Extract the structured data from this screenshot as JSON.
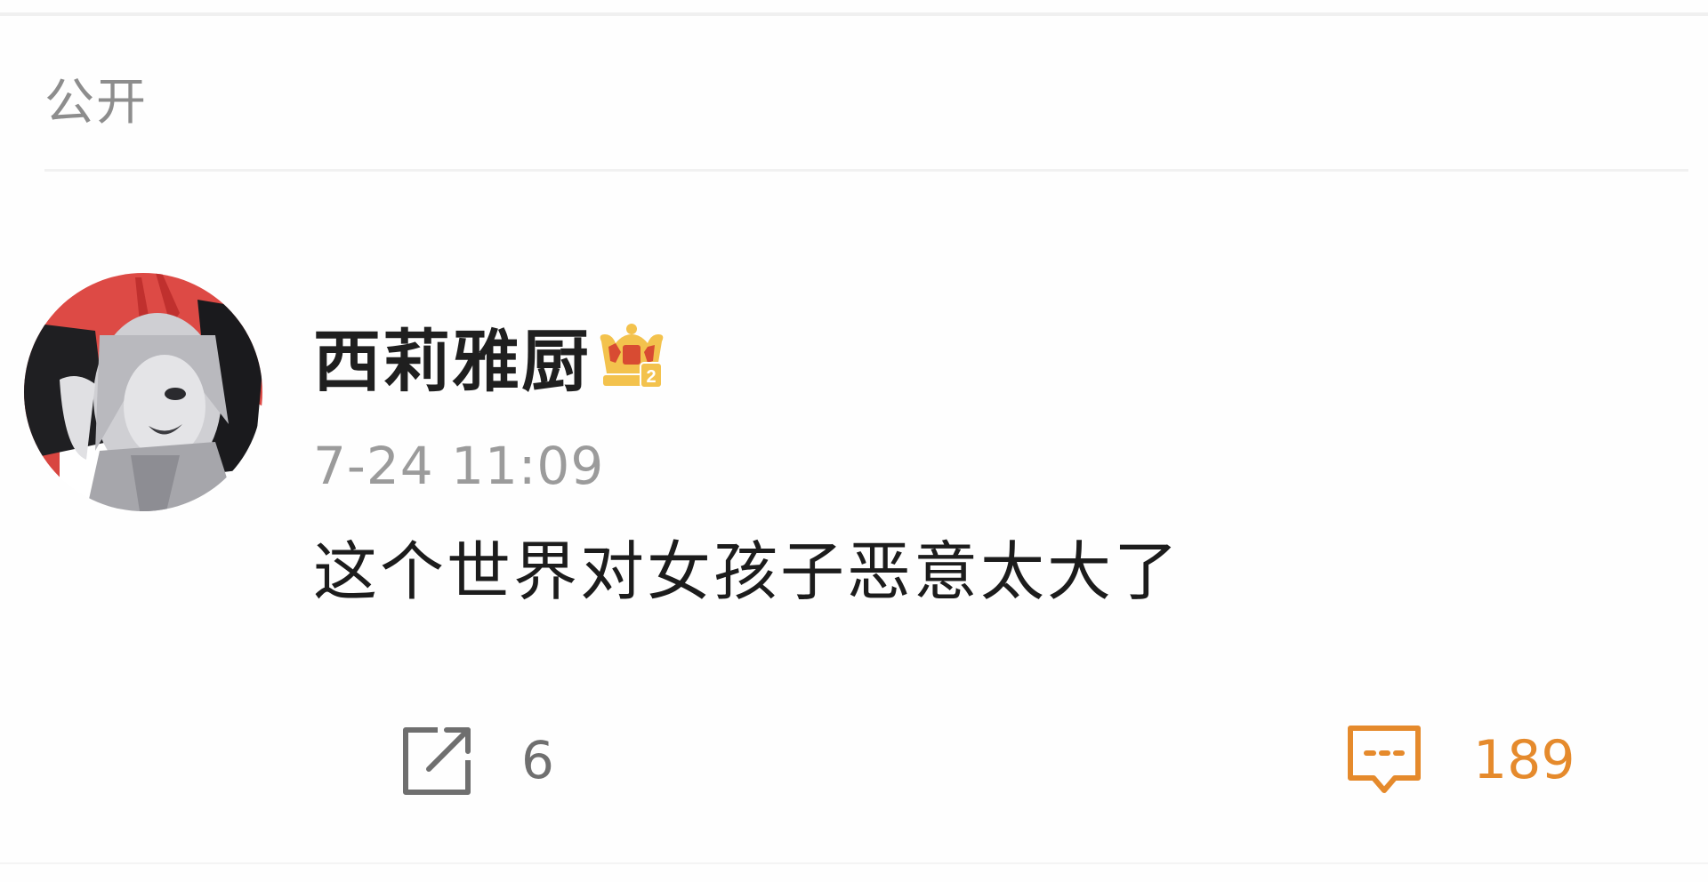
{
  "post": {
    "visibility": "公开"
  },
  "comment": {
    "author": {
      "name": "西莉雅厨",
      "avatar_icon": "anime-avatar",
      "badge_icon": "crown-vip-icon",
      "badge_level": "2"
    },
    "timestamp": "7-24 11:09",
    "text": "这个世界对女孩子恶意太大了"
  },
  "actions": {
    "share": {
      "icon": "share-icon",
      "count": "6"
    },
    "comment": {
      "icon": "comment-icon",
      "count": "189"
    }
  },
  "colors": {
    "accent": "#e58a2c",
    "badge_gold": "#f3c24d",
    "badge_red": "#d84b32",
    "muted_text": "#9b9b9b",
    "primary_text": "#1f1f1f"
  }
}
